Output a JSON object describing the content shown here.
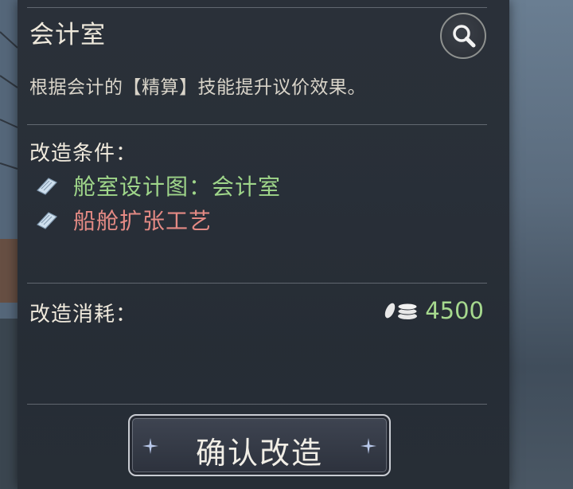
{
  "panel": {
    "title": "会计室",
    "description": "根据会计的【精算】技能提升议价效果。",
    "zoom_icon": "magnifier-icon"
  },
  "requirements": {
    "label": "改造条件：",
    "items": [
      {
        "text": "舱室设计图：会计室",
        "status": "met",
        "icon": "blueprint-icon",
        "color": "#9fd68a"
      },
      {
        "text": "船舱扩张工艺",
        "status": "unmet",
        "icon": "blueprint-icon",
        "color": "#e48a84"
      }
    ]
  },
  "cost": {
    "label": "改造消耗：",
    "icon": "silver-coins-icon",
    "value": "4500",
    "color": "#a6d98e"
  },
  "confirm": {
    "label": "确认改造"
  }
}
